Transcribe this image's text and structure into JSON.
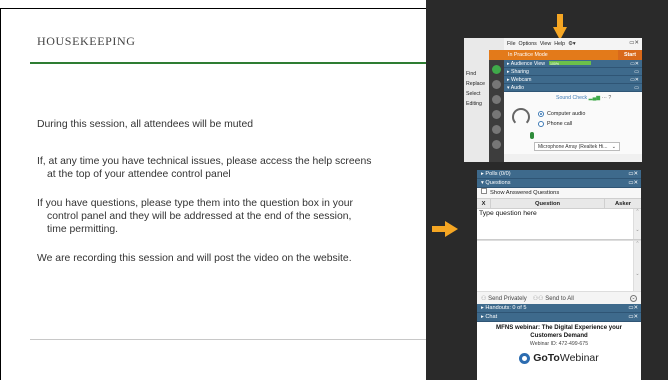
{
  "slide": {
    "title": "HOUSEKEEPING",
    "bullets": [
      {
        "line1": "During this session, all attendees will be muted",
        "line2": "",
        "line3": ""
      },
      {
        "line1": "If, at any time you have technical issues, please access the help screens",
        "line2": "at the top of your attendee control panel",
        "line3": ""
      },
      {
        "line1": "If you have questions, please type them into the question box in your",
        "line2": "control panel and they will be addressed at the end of the session,",
        "line3": "time permitting."
      },
      {
        "line1": "We are recording this session and will post the video on the website.",
        "line2": "",
        "line3": ""
      }
    ]
  },
  "control_panel_top": {
    "side_menu": [
      "Find",
      "Replace",
      "Select",
      "Editing"
    ],
    "menus": [
      "File",
      "Options",
      "View",
      "Help"
    ],
    "practice_mode": "In Practice Mode",
    "start_label": "Start",
    "panes": {
      "audience_view": "Audience View",
      "audience_view_value": "100%",
      "sharing": "Sharing",
      "webcam": "Webcam",
      "audio": "Audio"
    },
    "sound_check": "Sound Check",
    "computer_audio": "Computer audio",
    "phone_call": "Phone call",
    "microphone": "Microphone Array (Realtek Hi..."
  },
  "control_panel_bottom": {
    "polls": "Polls (0/0)",
    "questions": "Questions",
    "show_answered": "Show Answered Questions",
    "columns": [
      "X",
      "Question",
      "Asker"
    ],
    "question_placeholder": "Type question here",
    "send_privately": "Send Privately",
    "send_to_all": "Send to All",
    "handouts": "Handouts: 0 of 5",
    "chat": "Chat",
    "webinar_title": "MFNS webinar: The Digital Experience your Customers Demand",
    "webinar_id": "Webinar ID: 472-499-675",
    "brand_goto": "GoTo",
    "brand_webinar": "Webinar"
  },
  "colors": {
    "accent_green": "#2e7d32",
    "arrow_orange": "#f5a623",
    "practice_orange": "#e37a1a",
    "pane_blue": "#3e6a8c",
    "panel_dark": "#2a2a2a"
  }
}
